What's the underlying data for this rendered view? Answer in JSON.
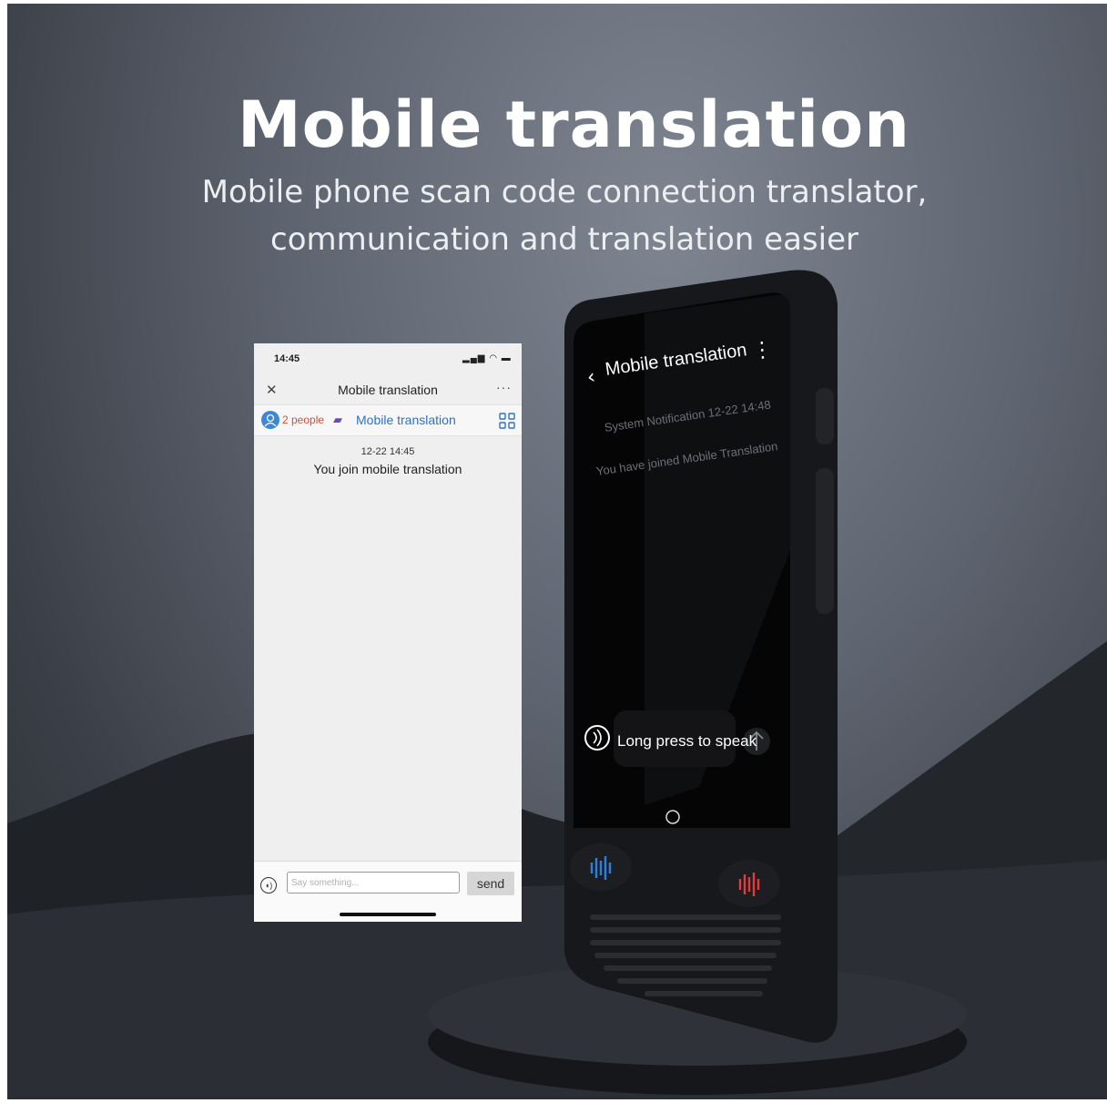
{
  "hero": {
    "title": "Mobile translation",
    "subtitle_line1": "Mobile phone scan code connection translator,",
    "subtitle_line2": "communication and translation easier"
  },
  "phone_app": {
    "status_time": "14:45",
    "title": "Mobile translation",
    "participants": "2 people",
    "session_name": "Mobile translation",
    "message_timestamp": "12-22 14:45",
    "message_text": "You join mobile translation",
    "input_placeholder": "Say something...",
    "send_label": "send"
  },
  "device_screen": {
    "title": "Mobile translation",
    "notification": "System Notification 12-22 14:48",
    "joined_text": "You have joined Mobile Translation",
    "speak_label": "Long press to speak"
  },
  "colors": {
    "people_red": "#d84d3c",
    "link_blue": "#2f72c4",
    "mic_blue": "#2f7fe0",
    "mic_red": "#e23b3b"
  }
}
